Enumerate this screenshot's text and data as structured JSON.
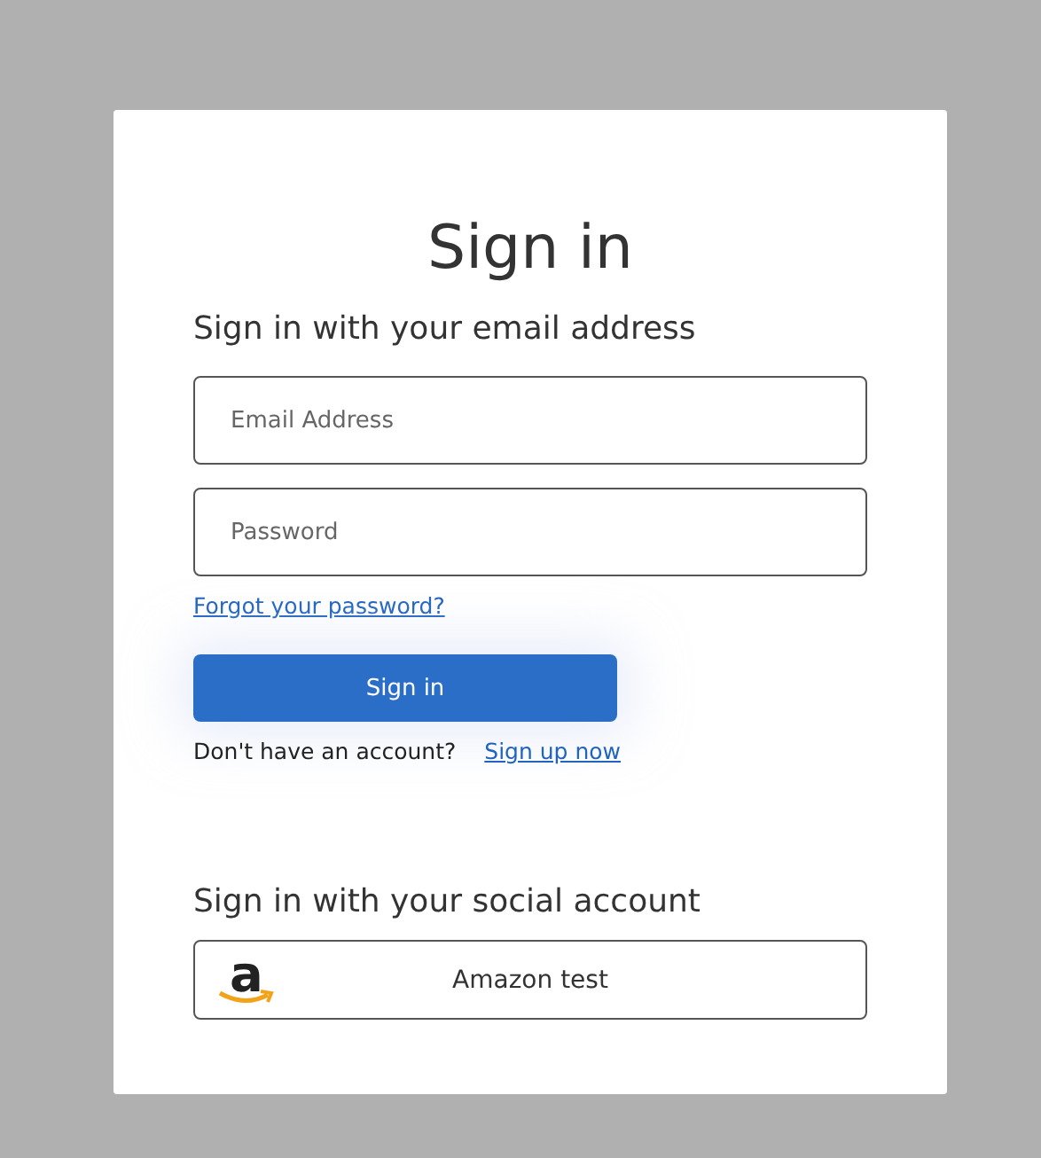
{
  "title": "Sign in",
  "local_heading": "Sign in with your email address",
  "fields": [
    {
      "placeholder": "Email Address"
    },
    {
      "placeholder": "Password"
    }
  ],
  "forgot_link": "Forgot your password?",
  "submit_button": "Sign in",
  "signup_prompt": "Don't have an account?",
  "signup_link": "Sign up now",
  "social_heading": "Sign in with your social account",
  "social_buttons": [
    {
      "logo_letter": "a",
      "label": "Amazon test"
    }
  ]
}
